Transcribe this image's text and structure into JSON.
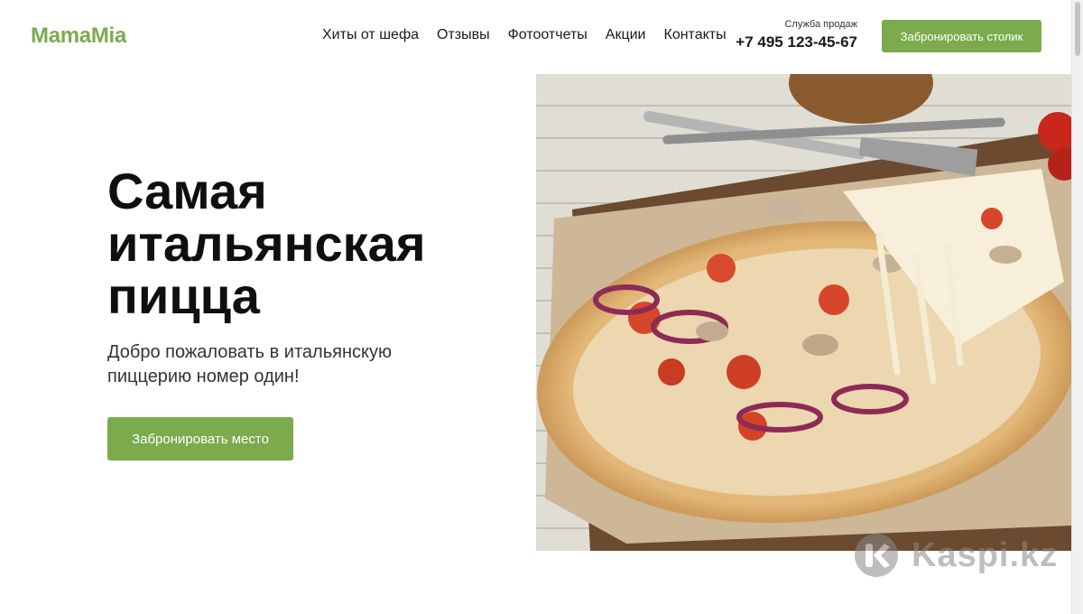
{
  "header": {
    "logo": "MamaMia",
    "nav": [
      {
        "label": "Хиты от шефа"
      },
      {
        "label": "Отзывы"
      },
      {
        "label": "Фотоотчеты"
      },
      {
        "label": "Акции"
      },
      {
        "label": "Контакты"
      }
    ],
    "phone_caption": "Служба продаж",
    "phone_number": "+7 495 123-45-67",
    "cta_label": "Забронировать столик"
  },
  "hero": {
    "title_lines": [
      "Самая",
      "итальянская",
      "пицца"
    ],
    "subtitle": "Добро пожаловать в итальянскую пиццерию номер один!",
    "cta_label": "Забронировать место",
    "image_icon": "pizza-photo"
  },
  "watermark": {
    "text": "Kaspi.kz",
    "icon": "kaspi-logo-icon"
  },
  "colors": {
    "accent": "#7bab4c",
    "text": "#111111",
    "muted_text": "#333333"
  }
}
